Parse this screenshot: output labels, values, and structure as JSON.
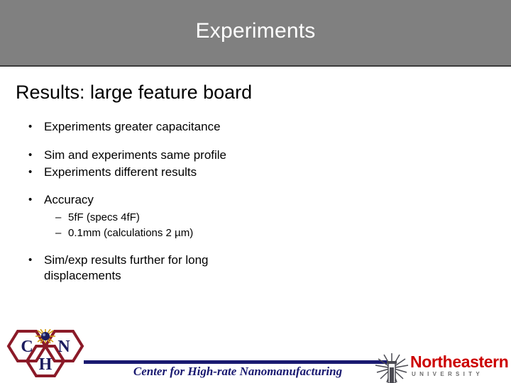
{
  "banner": {
    "title": "Experiments",
    "background_color": "#808080",
    "text_color": "#ffffff"
  },
  "slide": {
    "title": "Results: large feature board",
    "bullets": [
      {
        "marker": "•",
        "text": "Experiments greater capacitance"
      },
      {
        "marker": "•",
        "text": "Sim and experiments same profile"
      },
      {
        "marker": "•",
        "text": "Experiments different results"
      },
      {
        "marker": "•",
        "text": "Accuracy"
      },
      {
        "marker": "–",
        "text": "5fF (specs 4fF)"
      },
      {
        "marker": "–",
        "text": "0.1mm (calculations 2 µm)"
      },
      {
        "marker": "•",
        "text": "Sim/exp results further for long displacements"
      }
    ]
  },
  "footer": {
    "chn_logo": {
      "letters": [
        "C",
        "H",
        "N"
      ],
      "hex_color": "#8b1a28",
      "letter_color": "#1b1b5e",
      "burst_color": "#d4a017"
    },
    "caption": "Center for High-rate Nanomanufacturing",
    "caption_color": "#191970",
    "rule_color": "#191970",
    "northeastern": {
      "wordmark": "Northeastern",
      "subtitle": "UNIVERSITY",
      "wordmark_color": "#cc0000",
      "subtitle_color": "#6e6e6e",
      "emblem_color": "#4a4a52"
    }
  }
}
